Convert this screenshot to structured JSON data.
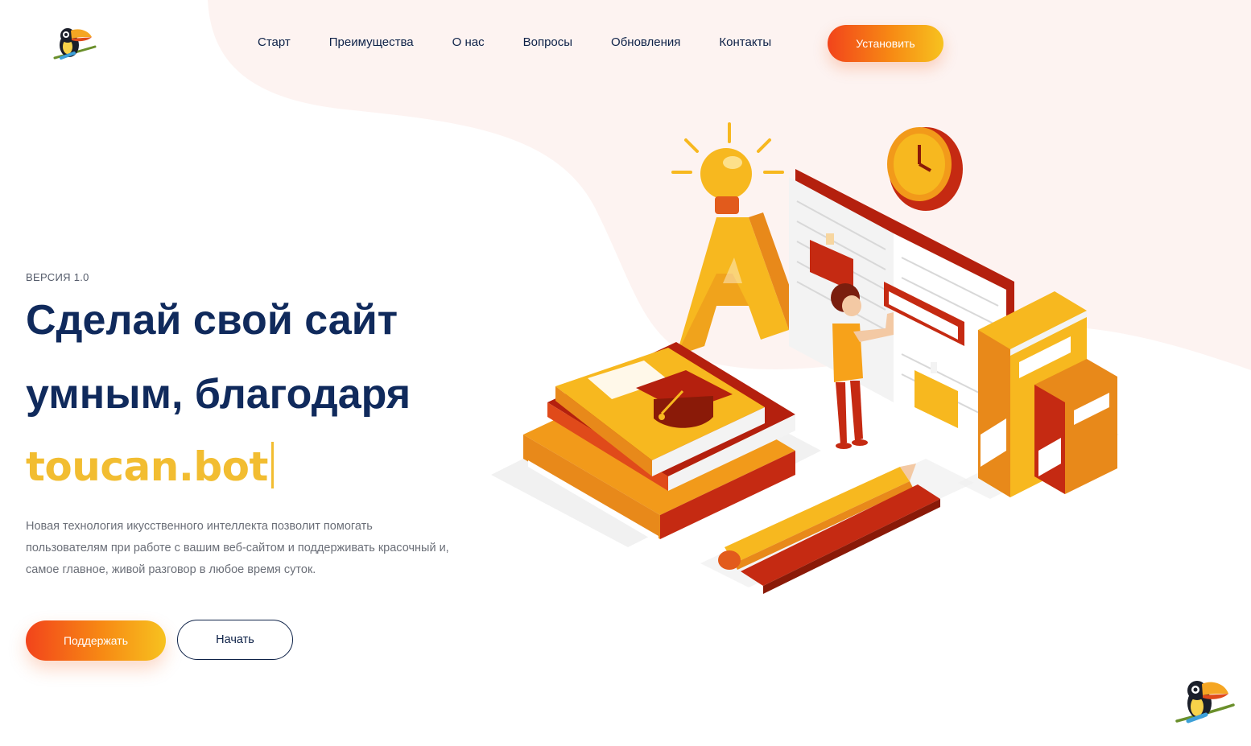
{
  "header": {
    "logo_icon": "toucan-logo-icon",
    "nav_items": [
      "Старт",
      "Преимущества",
      "О нас",
      "Вопросы",
      "Обновления",
      "Контакты"
    ],
    "install_label": "Установить"
  },
  "hero": {
    "version": "ВЕРСИЯ 1.0",
    "headline_line1": "Сделай свой сайт",
    "headline_line2": "умным, благодаря",
    "brand": "toucan.bot",
    "description_lines": [
      "Новая технология икусственного интеллекта позволит помогать",
      "пользователям при работе с вашим веб-сайтом и поддерживать красочный и,",
      "самое главное, живой разговор в любое время суток."
    ],
    "primary_button": "Поддержать",
    "secondary_button": "Начать"
  },
  "illustration": {
    "icon": "education-illustration"
  },
  "chat_widget": {
    "icon": "toucan-chat-widget-icon"
  },
  "colors": {
    "navy": "#102a5c",
    "brand_yellow": "#f2bd31",
    "gradient_start": "#f2441b",
    "gradient_end": "#f7c21f",
    "blob": "#fdf3f1"
  }
}
